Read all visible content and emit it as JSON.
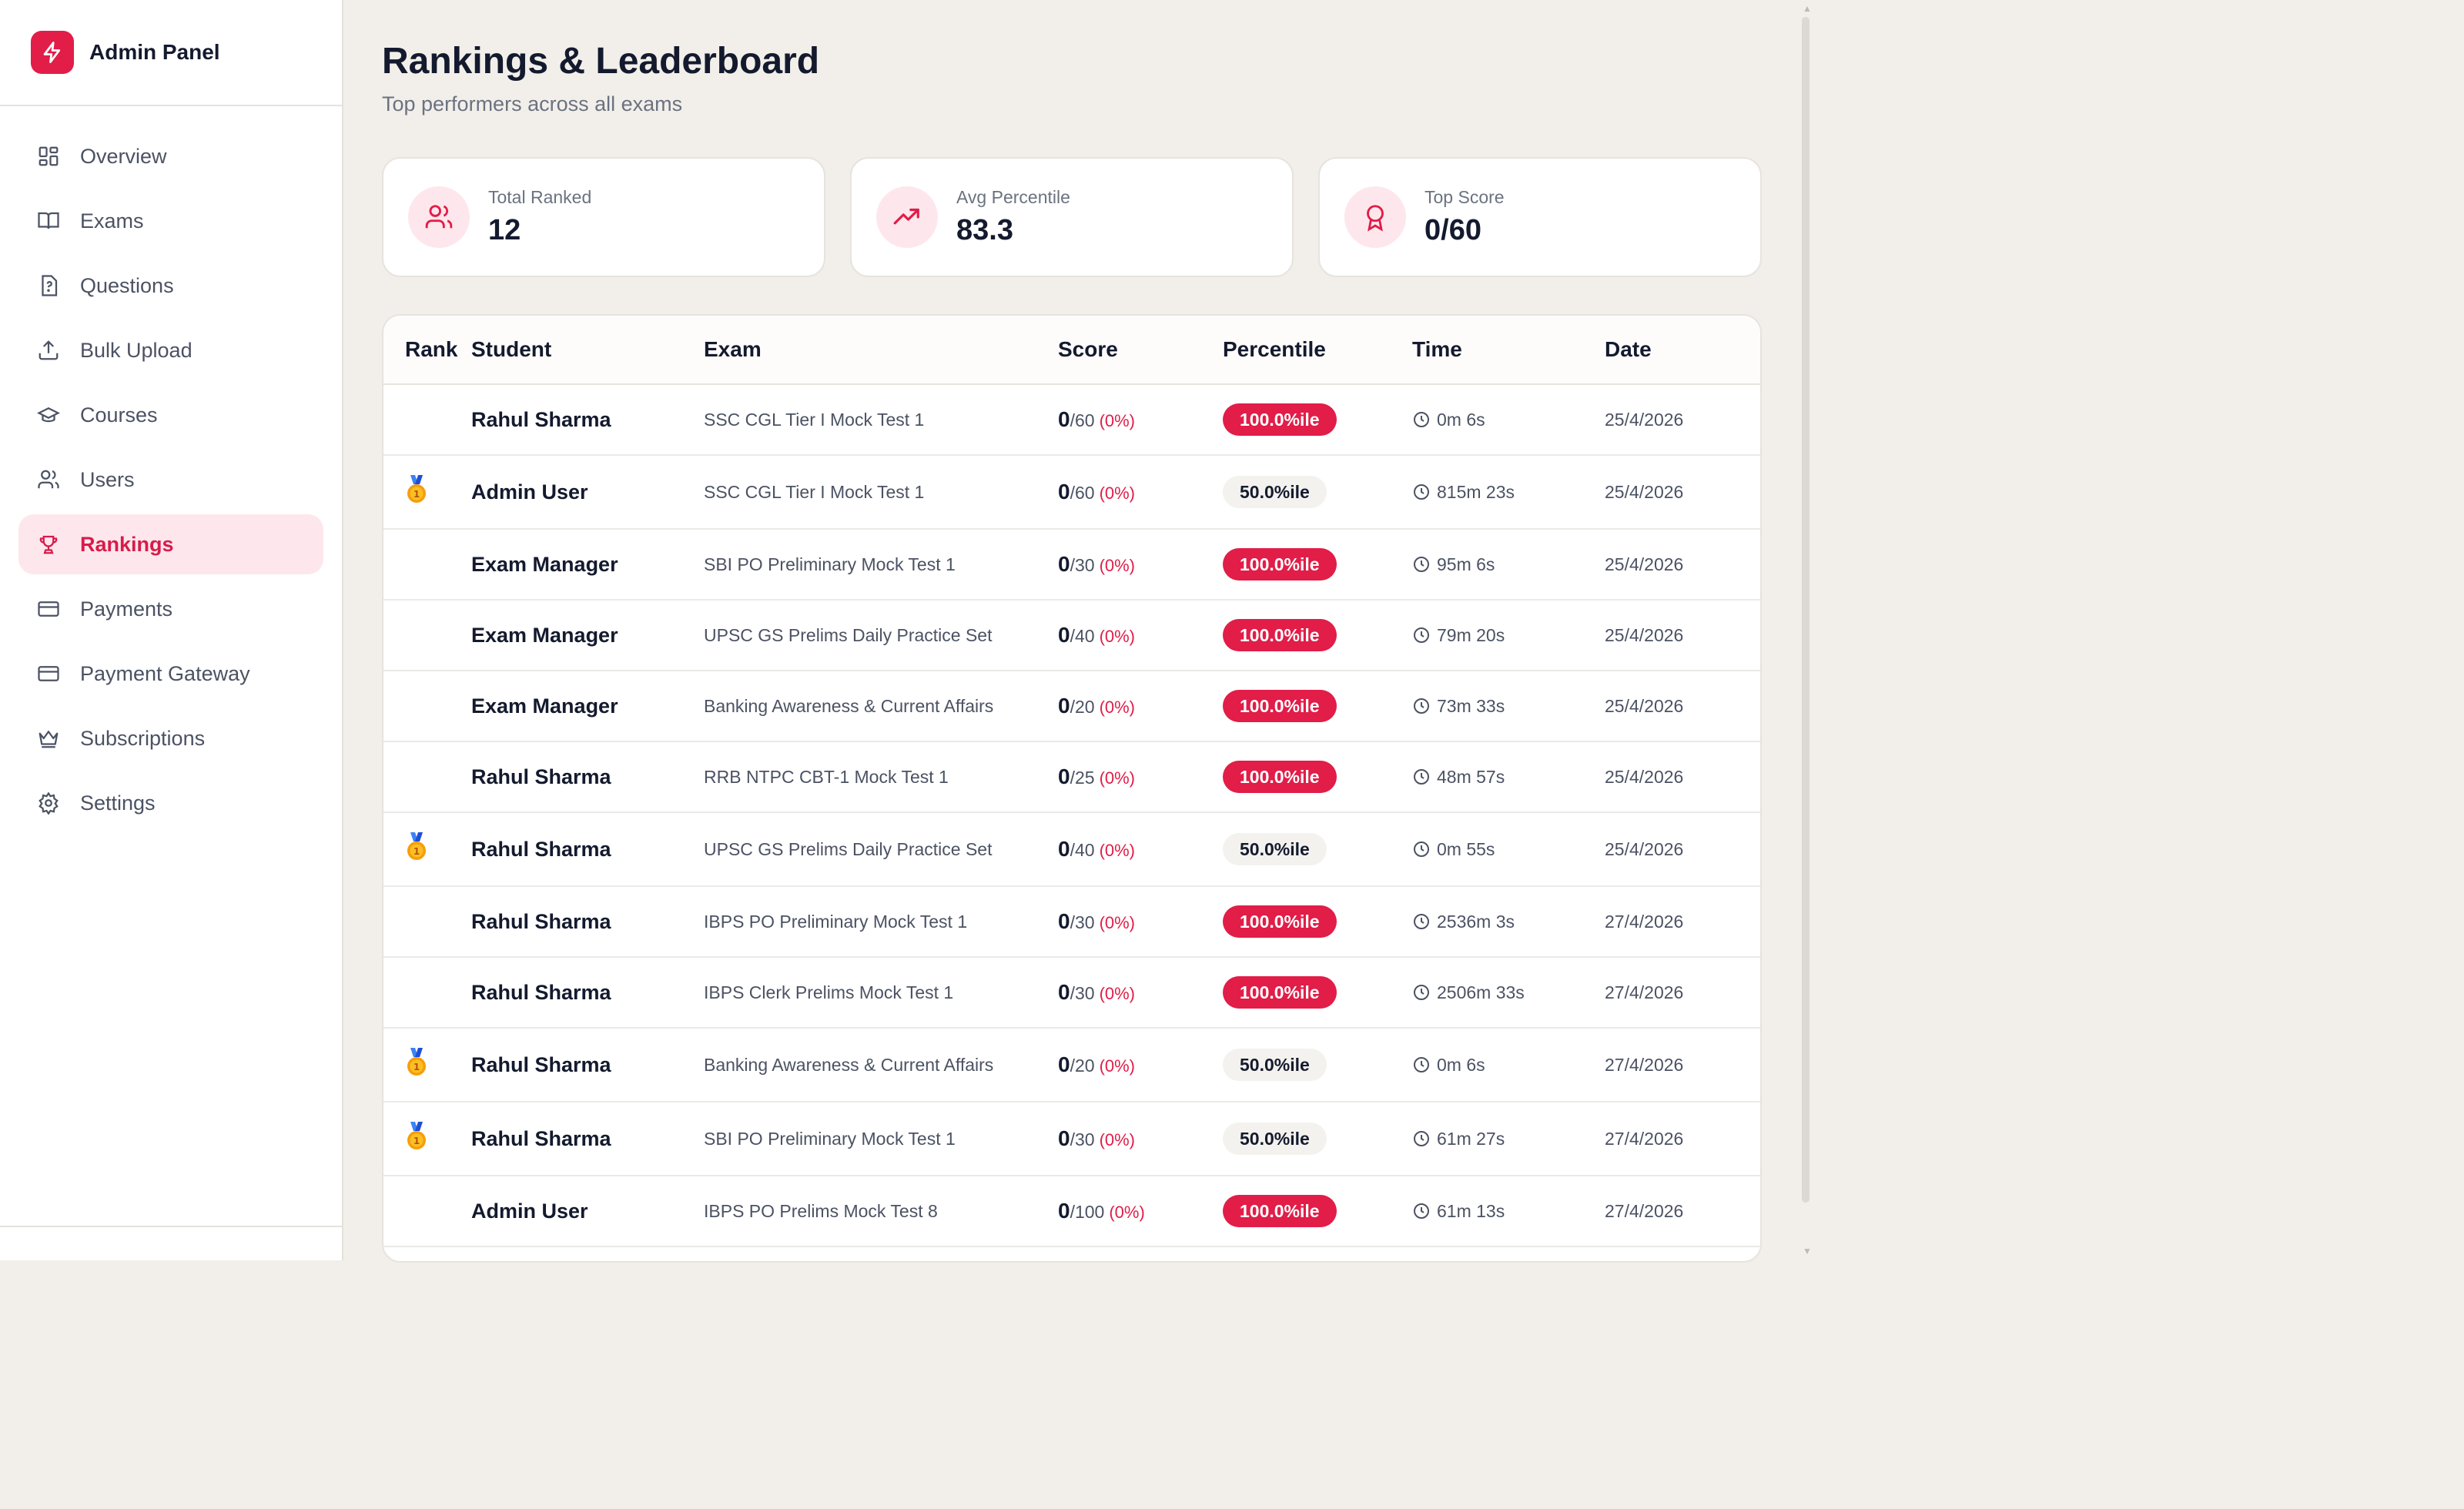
{
  "sidebar": {
    "brand": "Admin Panel",
    "items": [
      {
        "label": "Overview",
        "icon": "grid-icon",
        "active": false
      },
      {
        "label": "Exams",
        "icon": "book-icon",
        "active": false
      },
      {
        "label": "Questions",
        "icon": "file-question-icon",
        "active": false
      },
      {
        "label": "Bulk Upload",
        "icon": "upload-icon",
        "active": false
      },
      {
        "label": "Courses",
        "icon": "graduation-cap-icon",
        "active": false
      },
      {
        "label": "Users",
        "icon": "users-icon",
        "active": false
      },
      {
        "label": "Rankings",
        "icon": "trophy-icon",
        "active": true
      },
      {
        "label": "Payments",
        "icon": "credit-card-icon",
        "active": false
      },
      {
        "label": "Payment Gateway",
        "icon": "credit-card-icon",
        "active": false
      },
      {
        "label": "Subscriptions",
        "icon": "crown-icon",
        "active": false
      },
      {
        "label": "Settings",
        "icon": "gear-icon",
        "active": false
      }
    ]
  },
  "header": {
    "title": "Rankings & Leaderboard",
    "subtitle": "Top performers across all exams"
  },
  "stats": [
    {
      "label": "Total Ranked",
      "value": "12",
      "icon": "users-icon"
    },
    {
      "label": "Avg Percentile",
      "value": "83.3",
      "icon": "trending-up-icon"
    },
    {
      "label": "Top Score",
      "value": "0/60",
      "icon": "award-icon"
    }
  ],
  "table": {
    "columns": [
      "Rank",
      "Student",
      "Exam",
      "Score",
      "Percentile",
      "Time",
      "Date"
    ],
    "rows": [
      {
        "medal": false,
        "student": "Rahul Sharma",
        "exam": "SSC CGL Tier I Mock Test 1",
        "score": "0",
        "total": "/60",
        "pct": "(0%)",
        "percentile": "100.0%ile",
        "high": true,
        "time": "0m 6s",
        "date": "25/4/2026"
      },
      {
        "medal": true,
        "student": "Admin User",
        "exam": "SSC CGL Tier I Mock Test 1",
        "score": "0",
        "total": "/60",
        "pct": "(0%)",
        "percentile": "50.0%ile",
        "high": false,
        "time": "815m 23s",
        "date": "25/4/2026"
      },
      {
        "medal": false,
        "student": "Exam Manager",
        "exam": "SBI PO Preliminary Mock Test 1",
        "score": "0",
        "total": "/30",
        "pct": "(0%)",
        "percentile": "100.0%ile",
        "high": true,
        "time": "95m 6s",
        "date": "25/4/2026"
      },
      {
        "medal": false,
        "student": "Exam Manager",
        "exam": "UPSC GS Prelims Daily Practice Set",
        "score": "0",
        "total": "/40",
        "pct": "(0%)",
        "percentile": "100.0%ile",
        "high": true,
        "time": "79m 20s",
        "date": "25/4/2026"
      },
      {
        "medal": false,
        "student": "Exam Manager",
        "exam": "Banking Awareness & Current Affairs",
        "score": "0",
        "total": "/20",
        "pct": "(0%)",
        "percentile": "100.0%ile",
        "high": true,
        "time": "73m 33s",
        "date": "25/4/2026"
      },
      {
        "medal": false,
        "student": "Rahul Sharma",
        "exam": "RRB NTPC CBT-1 Mock Test 1",
        "score": "0",
        "total": "/25",
        "pct": "(0%)",
        "percentile": "100.0%ile",
        "high": true,
        "time": "48m 57s",
        "date": "25/4/2026"
      },
      {
        "medal": true,
        "student": "Rahul Sharma",
        "exam": "UPSC GS Prelims Daily Practice Set",
        "score": "0",
        "total": "/40",
        "pct": "(0%)",
        "percentile": "50.0%ile",
        "high": false,
        "time": "0m 55s",
        "date": "25/4/2026"
      },
      {
        "medal": false,
        "student": "Rahul Sharma",
        "exam": "IBPS PO Preliminary Mock Test 1",
        "score": "0",
        "total": "/30",
        "pct": "(0%)",
        "percentile": "100.0%ile",
        "high": true,
        "time": "2536m 3s",
        "date": "27/4/2026"
      },
      {
        "medal": false,
        "student": "Rahul Sharma",
        "exam": "IBPS Clerk Prelims Mock Test 1",
        "score": "0",
        "total": "/30",
        "pct": "(0%)",
        "percentile": "100.0%ile",
        "high": true,
        "time": "2506m 33s",
        "date": "27/4/2026"
      },
      {
        "medal": true,
        "student": "Rahul Sharma",
        "exam": "Banking Awareness & Current Affairs",
        "score": "0",
        "total": "/20",
        "pct": "(0%)",
        "percentile": "50.0%ile",
        "high": false,
        "time": "0m 6s",
        "date": "27/4/2026"
      },
      {
        "medal": true,
        "student": "Rahul Sharma",
        "exam": "SBI PO Preliminary Mock Test 1",
        "score": "0",
        "total": "/30",
        "pct": "(0%)",
        "percentile": "50.0%ile",
        "high": false,
        "time": "61m 27s",
        "date": "27/4/2026"
      },
      {
        "medal": false,
        "student": "Admin User",
        "exam": "IBPS PO Prelims Mock Test 8",
        "score": "0",
        "total": "/100",
        "pct": "(0%)",
        "percentile": "100.0%ile",
        "high": true,
        "time": "61m 13s",
        "date": "27/4/2026"
      }
    ]
  },
  "colors": {
    "accent": "#e11d48",
    "accent_light": "#fde7ec",
    "background": "#f2efea"
  }
}
